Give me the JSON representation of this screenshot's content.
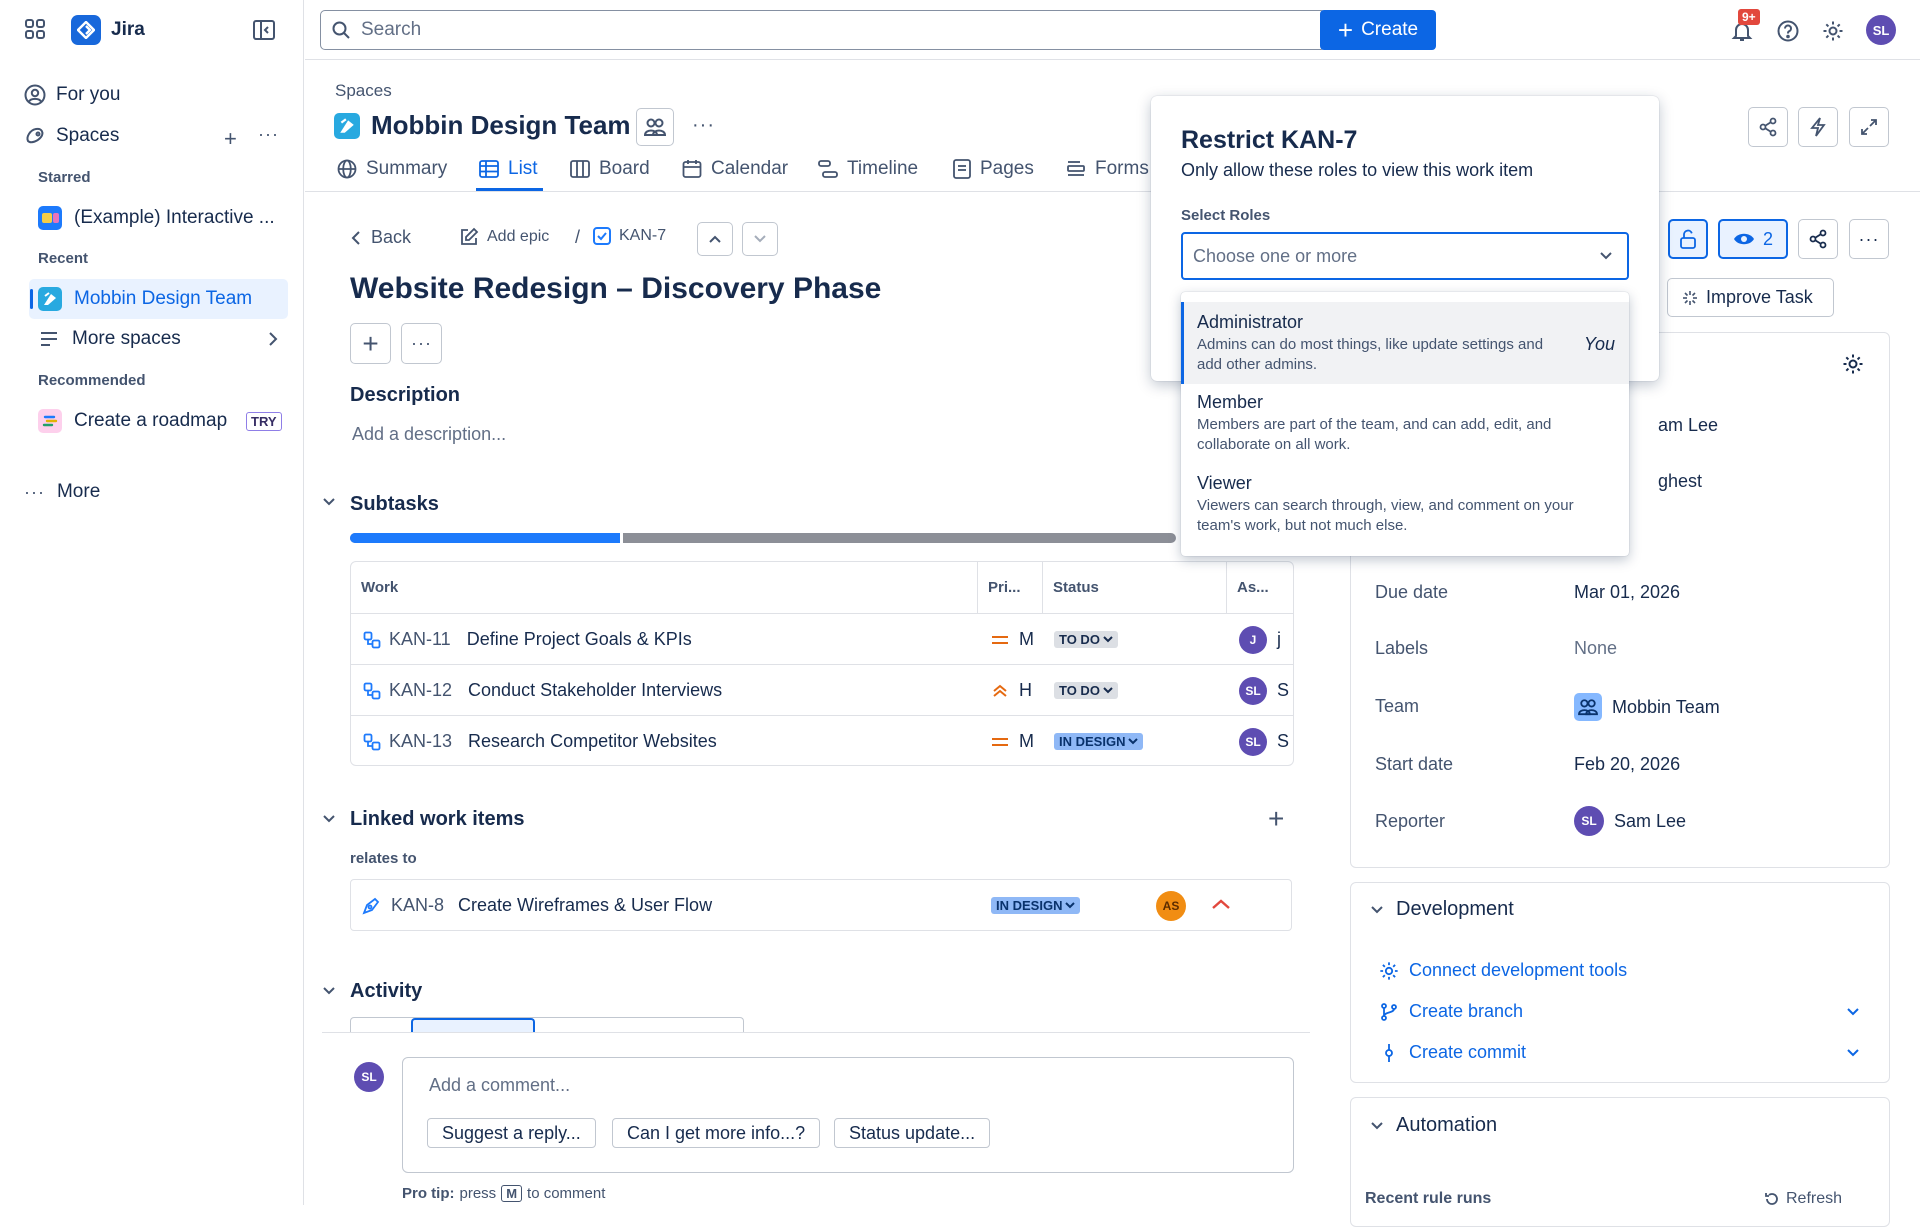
{
  "app": {
    "name": "Jira"
  },
  "sidebar": {
    "for_you": "For you",
    "spaces": "Spaces",
    "starred_heading": "Starred",
    "starred_item": "(Example) Interactive ...",
    "recent_heading": "Recent",
    "recent_item": "Mobbin Design Team",
    "more_spaces": "More spaces",
    "recommended_heading": "Recommended",
    "recommended_item": "Create a roadmap",
    "try_badge": "TRY",
    "more": "More"
  },
  "topbar": {
    "search_placeholder": "Search",
    "create_label": "Create",
    "notifications_badge": "9+",
    "user_initials": "SL"
  },
  "space": {
    "breadcrumb": "Spaces",
    "title": "Mobbin Design Team"
  },
  "tabs": [
    "Summary",
    "List",
    "Board",
    "Calendar",
    "Timeline",
    "Pages",
    "Forms"
  ],
  "issue": {
    "back": "Back",
    "add_epic": "Add epic",
    "key": "KAN-7",
    "title": "Website Redesign – Discovery Phase",
    "description_heading": "Description",
    "description_placeholder": "Add a description...",
    "subtasks_heading": "Subtasks",
    "subtasks_done_fraction": 0.33
  },
  "subtasks_table": {
    "headers": [
      "Work",
      "Pri...",
      "Status",
      "As..."
    ],
    "rows": [
      {
        "key": "KAN-11",
        "summary": "Define Project Goals & KPIs",
        "priority": "M",
        "status": "TO DO",
        "assignee_initial": "J",
        "assignee_trunc": "j"
      },
      {
        "key": "KAN-12",
        "summary": "Conduct Stakeholder Interviews",
        "priority": "H",
        "status": "TO DO",
        "assignee_initial": "SL",
        "assignee_trunc": "S"
      },
      {
        "key": "KAN-13",
        "summary": "Research Competitor Websites",
        "priority": "M",
        "status": "IN DESIGN",
        "assignee_initial": "SL",
        "assignee_trunc": "S"
      }
    ]
  },
  "linked": {
    "heading": "Linked work items",
    "relation": "relates to",
    "item": {
      "key": "KAN-8",
      "summary": "Create Wireframes & User Flow",
      "status": "IN DESIGN",
      "assignee_initial": "AS"
    }
  },
  "activity": {
    "heading": "Activity",
    "comment_placeholder": "Add a comment...",
    "suggestions": [
      "Suggest a reply...",
      "Can I get more info...?",
      "Status update..."
    ],
    "pro_tip_label": "Pro tip:",
    "pro_tip_press": "press",
    "pro_tip_key": "M",
    "pro_tip_rest": "to comment",
    "user_initials": "SL"
  },
  "toolbar_right": {
    "watchers_count": "2",
    "improve_task": "Improve Task"
  },
  "details": {
    "assignee_trunc": "am Lee",
    "priority_trunc": "ghest",
    "rows": [
      {
        "label": "Due date",
        "value": "Mar 01, 2026"
      },
      {
        "label": "Labels",
        "value": "None"
      },
      {
        "label": "Team",
        "value": "Mobbin Team"
      },
      {
        "label": "Start date",
        "value": "Feb 20, 2026"
      },
      {
        "label": "Reporter",
        "value": "Sam Lee",
        "initials": "SL"
      }
    ]
  },
  "development": {
    "heading": "Development",
    "connect": "Connect development tools",
    "branch": "Create branch",
    "commit": "Create commit"
  },
  "automation": {
    "heading": "Automation",
    "recent_runs": "Recent rule runs",
    "refresh": "Refresh"
  },
  "restrict_popup": {
    "title": "Restrict KAN-7",
    "subtitle": "Only allow these roles to view this work item",
    "select_label": "Select Roles",
    "select_placeholder": "Choose one or more",
    "options": [
      {
        "name": "Administrator",
        "desc": "Admins can do most things, like update settings and add other admins.",
        "tag": "You"
      },
      {
        "name": "Member",
        "desc": "Members are part of the team, and can add, edit, and collaborate on all work."
      },
      {
        "name": "Viewer",
        "desc": "Viewers can search through, view, and comment on your team's work, but not much else."
      }
    ]
  },
  "colors": {
    "brand": "#0c66e4",
    "selected_bg": "#e9f2ff",
    "progress_done": "#1d7afc",
    "progress_rest": "#8c8f97"
  }
}
